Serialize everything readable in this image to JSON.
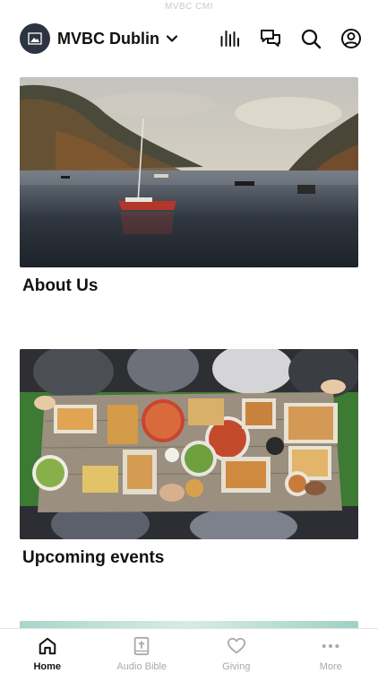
{
  "status_bar": {
    "text": "MVBC CMI"
  },
  "header": {
    "church_name": "MVBC Dublin",
    "icons": [
      "chevron-down-icon",
      "audio-bars-icon",
      "chat-icon",
      "search-icon",
      "profile-icon"
    ]
  },
  "cards": [
    {
      "title": "About Us",
      "image": "lake-with-sailboat"
    },
    {
      "title": "Upcoming events",
      "image": "table-of-food"
    }
  ],
  "tabbar": {
    "items": [
      {
        "label": "Home",
        "icon": "home-icon",
        "active": true
      },
      {
        "label": "Audio Bible",
        "icon": "bible-icon",
        "active": false
      },
      {
        "label": "Giving",
        "icon": "heart-icon",
        "active": false
      },
      {
        "label": "More",
        "icon": "more-dots-icon",
        "active": false
      }
    ]
  },
  "colors": {
    "logo_bg": "#2c3442",
    "active_tab": "#111111",
    "inactive_tab": "#a9a9a9"
  }
}
